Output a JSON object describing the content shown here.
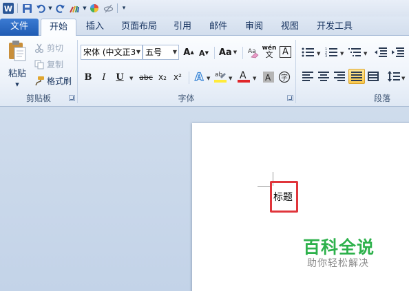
{
  "quick_access": {
    "app_icon": "word-icon",
    "items": [
      "save-icon",
      "undo-icon",
      "redo-icon",
      "paintbrush-icon",
      "color-icon",
      "customize-icon"
    ]
  },
  "tabs": [
    {
      "label": "文件"
    },
    {
      "label": "开始"
    },
    {
      "label": "插入"
    },
    {
      "label": "页面布局"
    },
    {
      "label": "引用"
    },
    {
      "label": "邮件"
    },
    {
      "label": "审阅"
    },
    {
      "label": "视图"
    },
    {
      "label": "开发工具"
    }
  ],
  "active_tab": "开始",
  "clipboard": {
    "paste_label": "粘贴",
    "cut_label": "剪切",
    "copy_label": "复制",
    "format_painter_label": "格式刷",
    "group_label": "剪贴板"
  },
  "font": {
    "font_name": "宋体 (中文正3",
    "font_size": "五号",
    "grow_label": "A",
    "shrink_label": "A",
    "case_label": "Aa",
    "phonetic_label": "wén",
    "border_label": "A",
    "bold_label": "B",
    "italic_label": "I",
    "underline_label": "U",
    "strike_label": "abc",
    "subscript_label": "x₂",
    "superscript_label": "x²",
    "group_label": "字体"
  },
  "paragraph": {
    "group_label": "段落"
  },
  "colors": {
    "file_tab": "#2a67c2",
    "highlight": "#ffeb3b",
    "font_color": "#e0262a",
    "heading_box": "#e0353b",
    "watermark": "#2db14b"
  },
  "document": {
    "heading_text": "标题"
  },
  "watermark": {
    "title": "百科全说",
    "subtitle": "助你轻松解决"
  }
}
